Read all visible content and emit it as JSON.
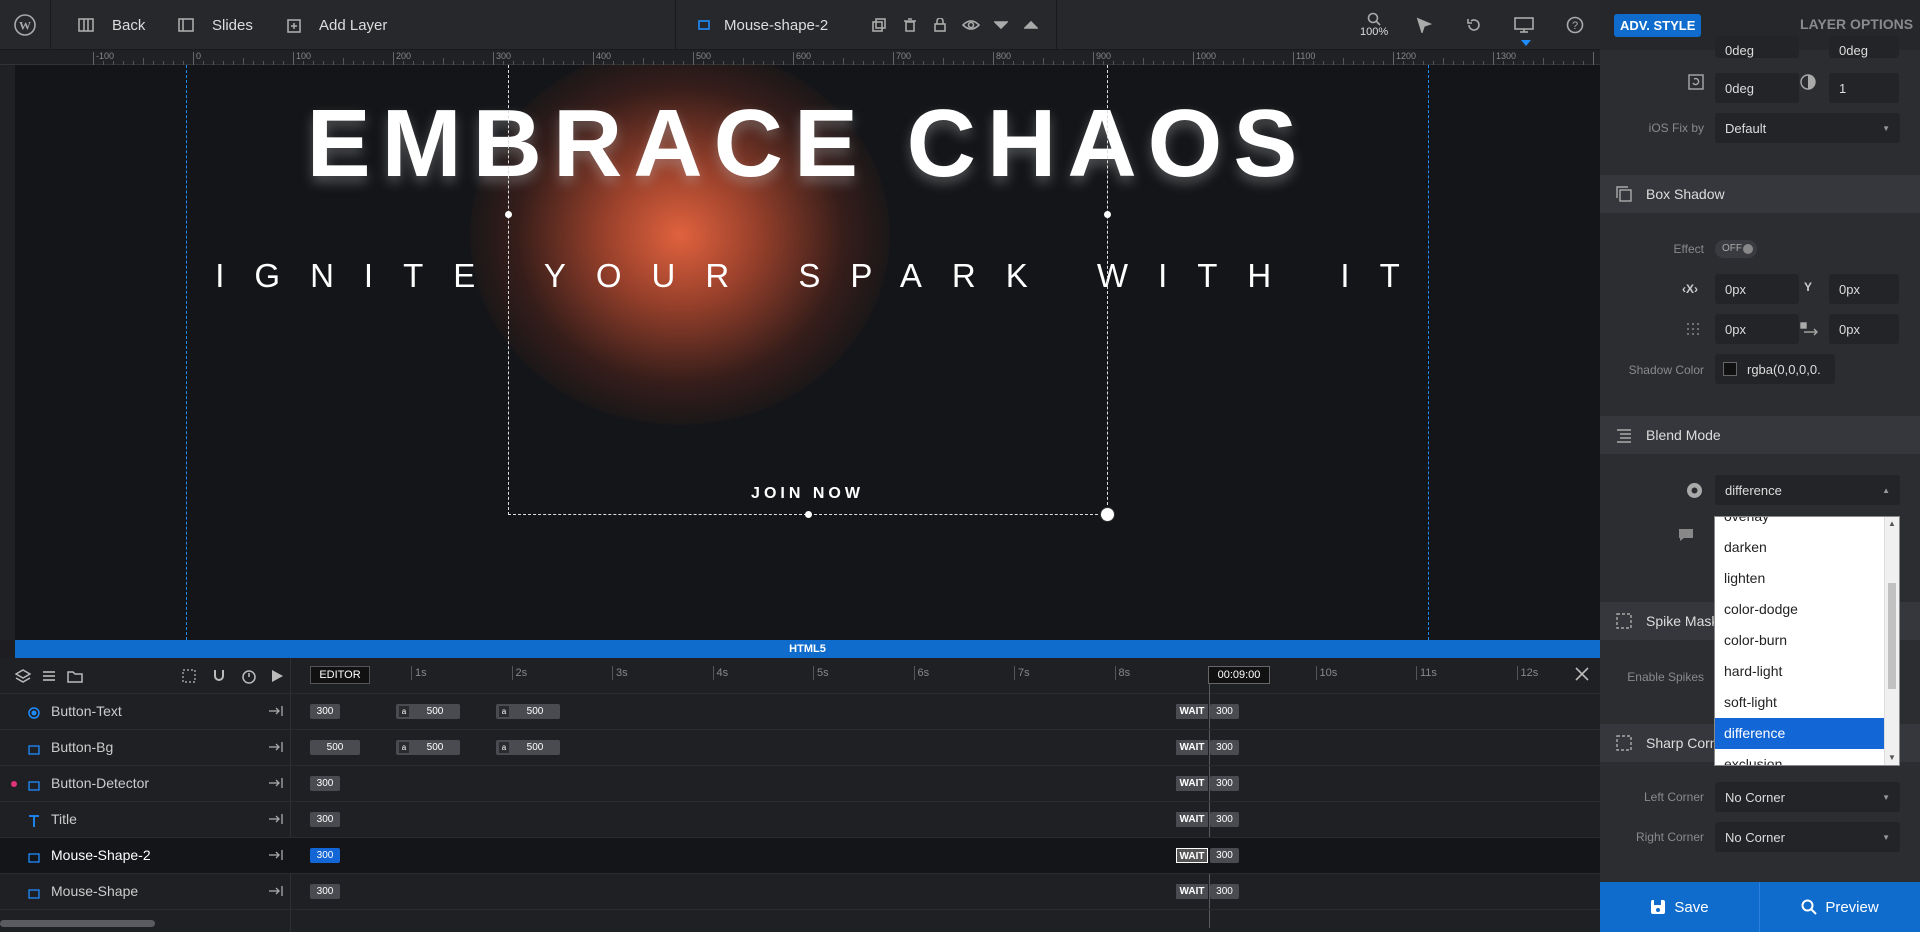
{
  "topbar": {
    "back": "Back",
    "slides": "Slides",
    "add_layer": "Add Layer",
    "layer_name": "Mouse-shape-2",
    "zoom": "100%"
  },
  "right_panel": {
    "tab_adv": "ADV. STYLE",
    "tab_layer": "LAYER OPTIONS",
    "top_val1": "0deg",
    "top_val2": "0deg",
    "rot_val": "0deg",
    "opacity_val": "1",
    "ios_label": "iOS Fix by",
    "ios_value": "Default",
    "box_shadow": "Box Shadow",
    "effect_label": "Effect",
    "effect_value": "OFF",
    "x_val": "0px",
    "y_val": "0px",
    "blur_val": "0px",
    "spread_val": "0px",
    "shadow_color_label": "Shadow Color",
    "shadow_color_value": "rgba(0,0,0,0.",
    "blend_mode": "Blend Mode",
    "blend_value": "difference",
    "spike_mask": "Spike Mask",
    "enable_spikes": "Enable Spikes",
    "sharp_corners": "Sharp Corn",
    "left_corner_label": "Left Corner",
    "left_corner_value": "No Corner",
    "right_corner_label": "Right Corner",
    "right_corner_value": "No Corner",
    "save": "Save",
    "preview": "Preview"
  },
  "blend_options": [
    "overlay",
    "darken",
    "lighten",
    "color-dodge",
    "color-burn",
    "hard-light",
    "soft-light",
    "difference",
    "exclusion"
  ],
  "blend_selected": "difference",
  "canvas": {
    "title": "EMBRACE CHAOS",
    "subtitle": "IGNITE YOUR SPARK WITH IT",
    "button": "JOIN NOW",
    "html5": "HTML5"
  },
  "ruler": [
    "-100",
    "0",
    "100",
    "200",
    "300",
    "400",
    "500",
    "600",
    "700",
    "800",
    "900",
    "1000",
    "1100",
    "1200",
    "1300"
  ],
  "timeline": {
    "editor": "EDITOR",
    "ticks": [
      "1s",
      "2s",
      "3s",
      "4s",
      "5s",
      "6s",
      "7s",
      "8s",
      "9s",
      "10s",
      "11s",
      "12s"
    ],
    "time": "00:09:00",
    "layers": [
      {
        "name": "Button-Text",
        "start": "300",
        "a1": "500",
        "a2": "500",
        "wait": "WAIT",
        "end": "300"
      },
      {
        "name": "Button-Bg",
        "start": "500",
        "a1": "500",
        "a2": "500",
        "wait": "WAIT",
        "end": "300"
      },
      {
        "name": "Button-Detector",
        "start": "300",
        "wait": "WAIT",
        "end": "300"
      },
      {
        "name": "Title",
        "start": "300",
        "wait": "WAIT",
        "end": "300"
      },
      {
        "name": "Mouse-Shape-2",
        "start": "300",
        "wait": "WAIT",
        "end": "300"
      },
      {
        "name": "Mouse-Shape",
        "start": "300",
        "wait": "WAIT",
        "end": "300"
      }
    ]
  },
  "colors": {
    "accent": "#0f6ccc",
    "canvas_bg": "#131518",
    "glow": "#e0623e",
    "selected": "#1366d6"
  }
}
